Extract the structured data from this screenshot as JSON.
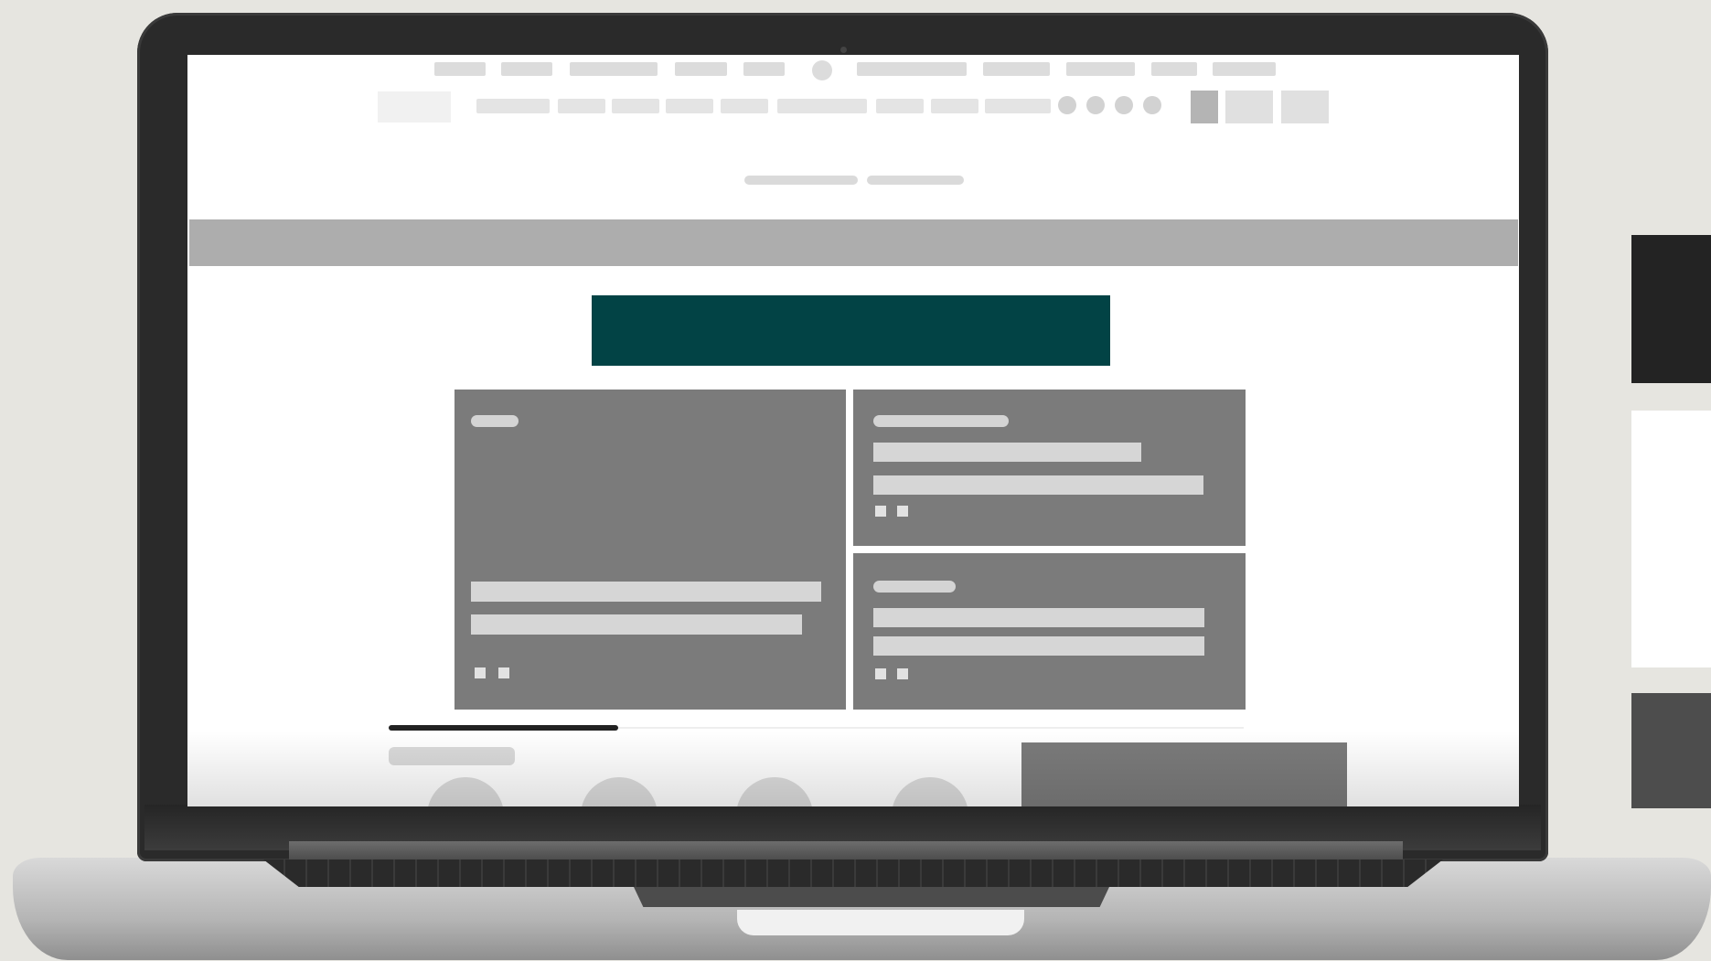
{
  "colors": {
    "background": "#e6e5e0",
    "laptop_frame": "#2a2a2a",
    "screen": "#ffffff",
    "promo_band": "#adadad",
    "hero_banner": "#024345",
    "card": "#7b7b7b",
    "placeholder_text": "#d6d6d6"
  },
  "icons": {
    "nav_center": "circle-icon",
    "header_social": [
      "social-icon",
      "social-icon",
      "social-icon",
      "social-icon"
    ],
    "header_actions": [
      "account-icon",
      "search-icon",
      "cart-icon"
    ]
  },
  "swatches": [
    {
      "name": "black",
      "color": "#232323"
    },
    {
      "name": "white",
      "color": "#ffffff"
    },
    {
      "name": "dark-gray",
      "color": "#4d4d4d"
    }
  ]
}
